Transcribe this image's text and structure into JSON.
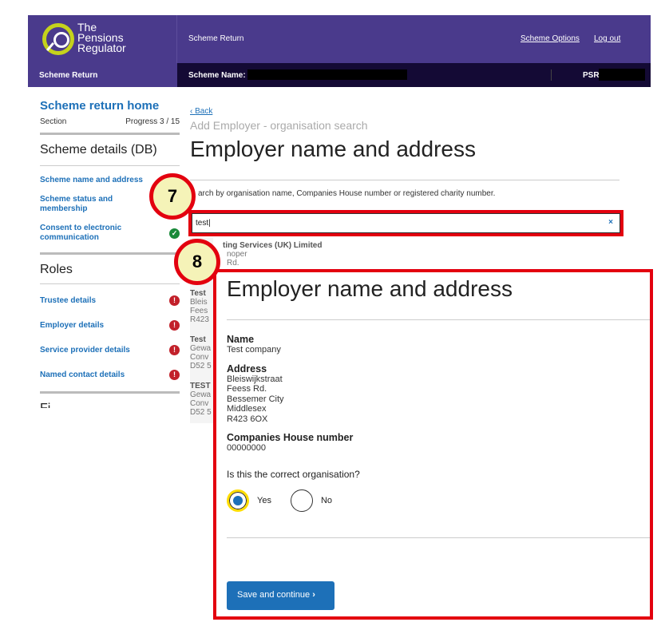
{
  "header": {
    "logo_text": [
      "The",
      "Pensions",
      "Regulator"
    ],
    "title": "Scheme Return",
    "links": [
      "Scheme Options",
      "Log out"
    ]
  },
  "subbar": {
    "left": "Scheme Return",
    "scheme_name_label": "Scheme Name:",
    "psr_label": "PSR:"
  },
  "sidebar": {
    "home": "Scheme return home",
    "section": "Section",
    "progress": "Progress 3 / 15",
    "group1": "Scheme details (DB)",
    "items1": [
      {
        "label": "Scheme name and address",
        "status": ""
      },
      {
        "label": "Scheme status and membership",
        "status": ""
      },
      {
        "label": "Consent to electronic communication",
        "status": "complete"
      }
    ],
    "group2": "Roles",
    "items2": [
      {
        "label": "Trustee details",
        "status": "error"
      },
      {
        "label": "Employer details",
        "status": "error"
      },
      {
        "label": "Service provider details",
        "status": "error"
      },
      {
        "label": "Named contact details",
        "status": "error"
      }
    ],
    "group3": "Fi"
  },
  "main": {
    "back": "Back",
    "caption": "Add Employer - organisation search",
    "title": "Employer name and address",
    "hint": "arch by organisation name, Companies House number or registered charity number.",
    "search_value": "test",
    "clear": "×",
    "results": [
      {
        "name": "ting Services (UK) Limited",
        "lines": [
          "noper",
          "Rd."
        ]
      },
      {
        "name": "Test",
        "lines": [
          "Bleis",
          "Fees",
          "R423"
        ]
      },
      {
        "name": "Test",
        "lines": [
          "Gewa",
          "Conv",
          "D52 5"
        ]
      },
      {
        "name": "TEST",
        "lines": [
          "Gewa",
          "Conv",
          "D52 5"
        ]
      }
    ]
  },
  "annotations": {
    "step7": "7",
    "step8": "8",
    "color": "#e3000f"
  },
  "overlay": {
    "title": "Employer name and address",
    "name_label": "Name",
    "name": "Test company",
    "address_label": "Address",
    "address": [
      "Bleiswijkstraat",
      "Feess Rd.",
      "Bessemer City",
      "Middlesex",
      "R423 6OX"
    ],
    "ch_label": "Companies House number",
    "ch": "00000000",
    "question": "Is this the correct organisation?",
    "yes": "Yes",
    "no": "No",
    "selected": "Yes",
    "save": "Save and continue"
  }
}
